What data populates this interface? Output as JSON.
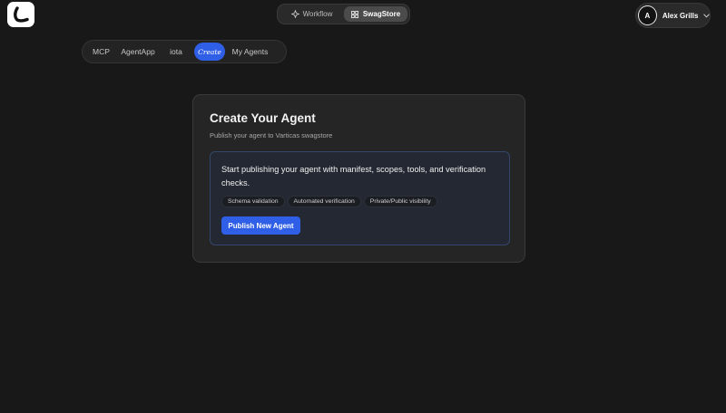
{
  "header": {
    "logo_icon": "app-logo-icon",
    "switch": [
      {
        "label": "Workflow",
        "icon": "sparkle-icon"
      },
      {
        "label": "SwagStore",
        "icon": "grid-icon",
        "active": true
      }
    ],
    "user": {
      "initial": "A",
      "name": "Alex Grills",
      "icon": "chevron-down-icon"
    }
  },
  "category_tabs": [
    {
      "label": "MCP"
    },
    {
      "label": "AgentApp"
    },
    {
      "label": "iota"
    },
    {
      "label": "Create",
      "active": true
    },
    {
      "label": "My Agents"
    }
  ],
  "card": {
    "title": "Create Your Agent",
    "subtitle": "Publish your agent to Varticas swagstore",
    "description": "Start publishing your agent with manifest, scopes, tools, and verification checks.",
    "chips": [
      "Schema validation",
      "Automated verification",
      "Private/Public visibility"
    ],
    "button_label": "Publish New Agent"
  },
  "colors": {
    "background": "#181818",
    "accent": "#2f5fe6",
    "card": "#252525",
    "inner_panel": "#232832",
    "inner_border": "#34466b"
  }
}
